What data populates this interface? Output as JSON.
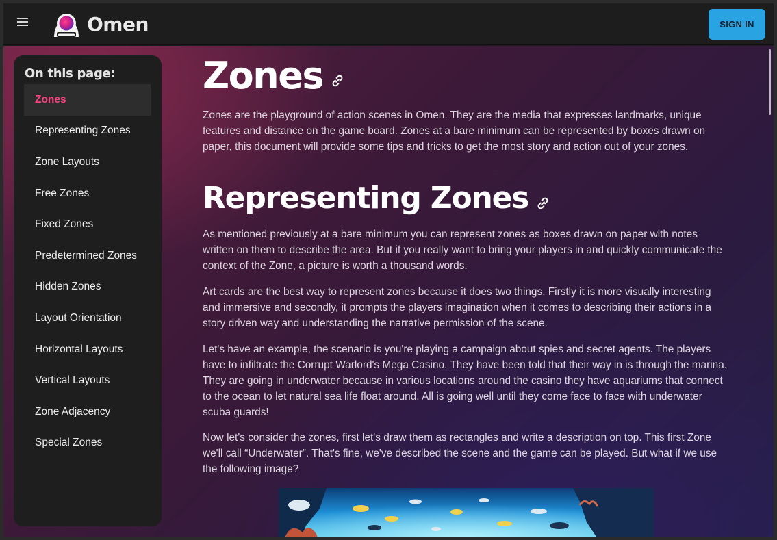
{
  "header": {
    "brand_name": "Omen",
    "menu_icon": "hamburger-menu-icon",
    "logo_icon": "omen-astronaut-logo",
    "signin_label": "SIGN IN",
    "accent_color": "#2aa3e3"
  },
  "sidebar": {
    "title": "On this page:",
    "active_color": "#f2457f",
    "items": [
      {
        "label": "Zones",
        "active": true
      },
      {
        "label": "Representing Zones"
      },
      {
        "label": "Zone Layouts"
      },
      {
        "label": "Free Zones"
      },
      {
        "label": "Fixed Zones"
      },
      {
        "label": "Predetermined Zones"
      },
      {
        "label": "Hidden Zones"
      },
      {
        "label": "Layout Orientation"
      },
      {
        "label": "Horizontal Layouts"
      },
      {
        "label": "Vertical Layouts"
      },
      {
        "label": "Zone Adjacency"
      },
      {
        "label": "Special Zones"
      }
    ]
  },
  "article": {
    "title": "Zones",
    "intro": "Zones are the playground of action scenes in Omen. They are the media that expresses landmarks, unique features and distance on the game board. Zones at a bare minimum can be represented by boxes drawn on paper, this document will provide some tips and tricks to get the most story and action out of your zones.",
    "section_title": "Representing Zones",
    "paragraphs": [
      "As mentioned previously at a bare minimum you can represent zones as boxes drawn on paper with notes written on them to describe the area. But if you really want to bring your players in and quickly communicate the context of the Zone, a picture is worth a thousand words.",
      "Art cards are the best way to represent zones because it does two things. Firstly it is more visually interesting and immersive and secondly, it prompts the players imagination when it comes to describing their actions in a story driven way and understanding the narrative permission of the scene.",
      "Let's have an example, the scenario is you're playing a campaign about spies and secret agents. The players have to infiltrate the Corrupt Warlord's Mega Casino. They have been told that their way in is through the marina. They are going in underwater because in various locations around the casino they have aquariums that connect to the ocean to let natural sea life float around. All is going well until they come face to face with underwater scuba guards!",
      "Now let's consider the zones, first let's draw them as rectangles and write a description on top. This first Zone we'll call “Underwater”. That's fine, we've described the scene and the game can be played. But what if we use the following image?"
    ],
    "image_subject": "underwater-aquarium-fish-image"
  }
}
